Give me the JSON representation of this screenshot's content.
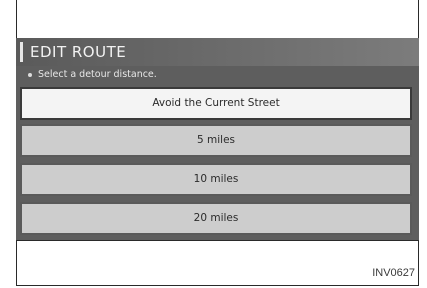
{
  "screen": {
    "title": "EDIT ROUTE",
    "prompt": "Select a detour distance.",
    "options": [
      {
        "label": "Avoid the Current Street",
        "selected": true
      },
      {
        "label": "5 miles",
        "selected": false
      },
      {
        "label": "10 miles",
        "selected": false
      },
      {
        "label": "20 miles",
        "selected": false
      }
    ]
  },
  "figure_id": "INV0627",
  "colors": {
    "title_bar": "#6a6a6a",
    "selected_option": "#f4f4f4",
    "option": "#cdcdcd",
    "screen_background": "#5e5e5e"
  }
}
